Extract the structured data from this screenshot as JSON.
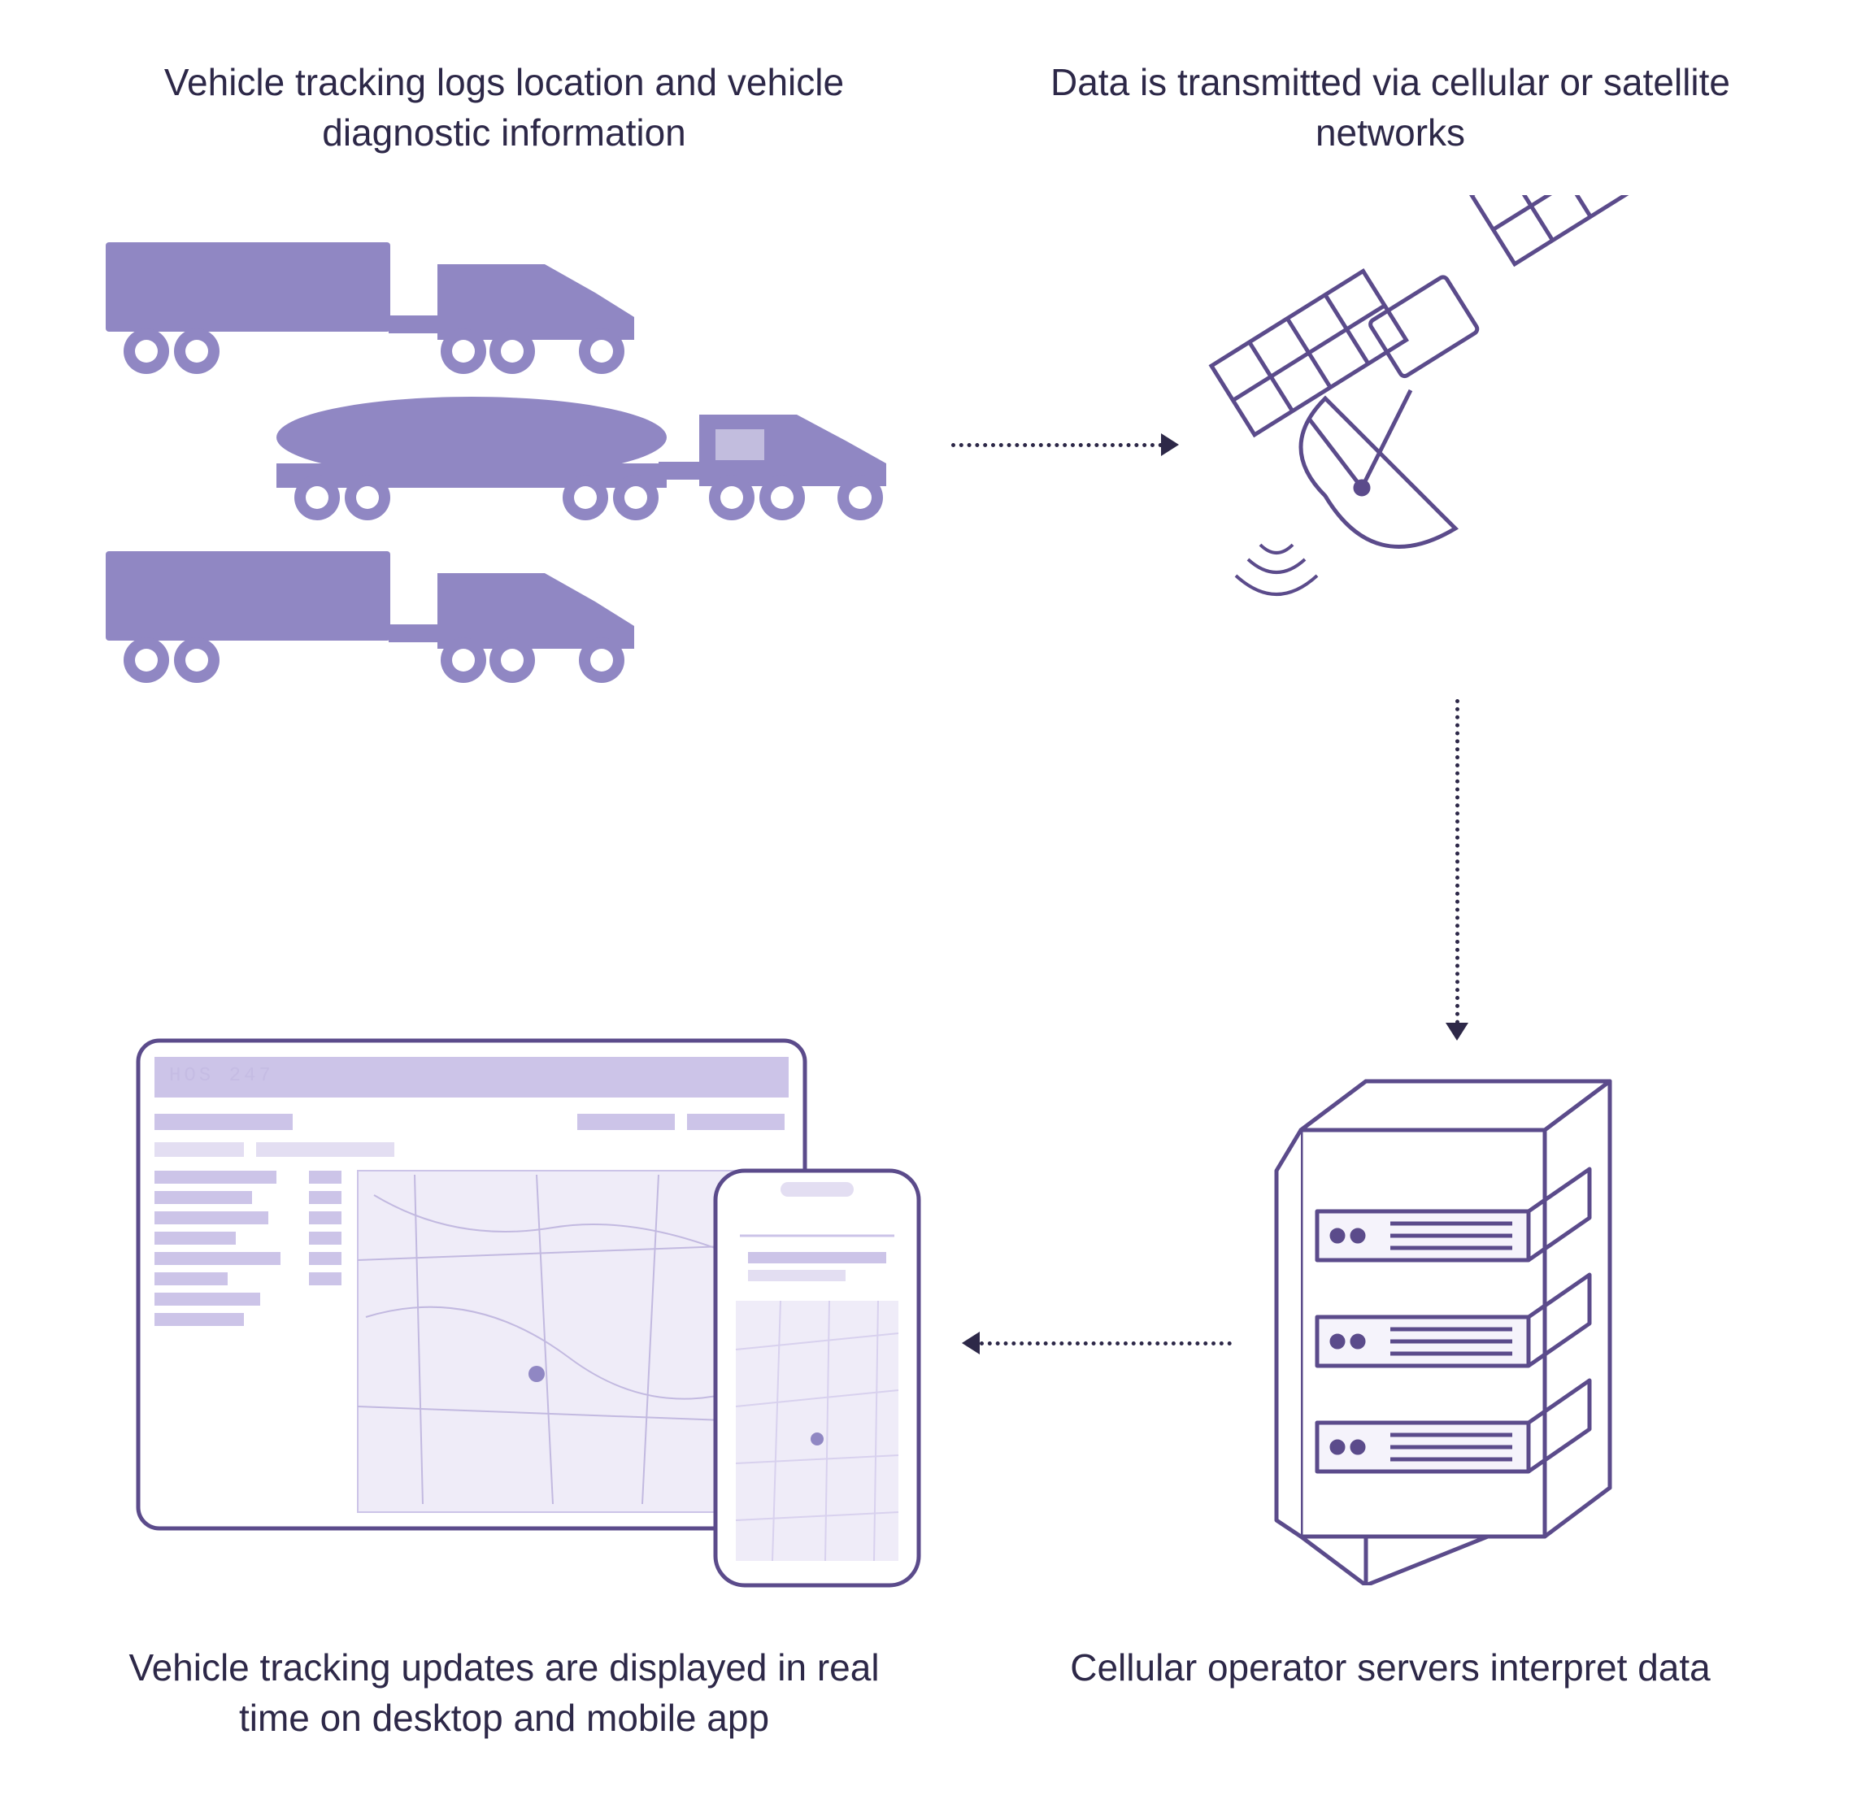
{
  "captions": {
    "step1": "Vehicle tracking logs location and vehicle diagnostic information",
    "step2": "Data is transmitted via cellular or satellite networks",
    "step3": "Cellular operator servers interpret data",
    "step4": "Vehicle tracking updates are displayed in real time on desktop and mobile app"
  },
  "monitor": {
    "brand_text": "HOS 247"
  },
  "colors": {
    "truck_fill": "#9087c3",
    "outline": "#5b4b8b",
    "pale": "#e5e1f4",
    "text": "#2d2848"
  },
  "flow": [
    "trucks",
    "satellite",
    "server",
    "devices"
  ]
}
